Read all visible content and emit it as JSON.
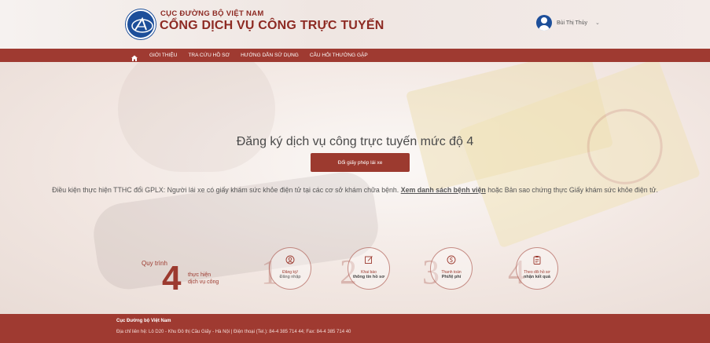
{
  "header": {
    "org_name": "CỤC ĐƯỜNG BỘ VIỆT NAM",
    "portal_name": "CỔNG DỊCH VỤ CÔNG TRỰC TUYẾN",
    "user_name": "Bùi Thị Thủy",
    "user_caret": "⌄"
  },
  "nav": {
    "items": [
      {
        "label": "GIỚI THIỆU"
      },
      {
        "label": "TRA CỨU HỒ SƠ"
      },
      {
        "label": "HƯỚNG DẪN SỬ DỤNG"
      },
      {
        "label": "CÂU HỎI THƯỜNG GẶP"
      }
    ]
  },
  "hero": {
    "title": "Đăng ký dịch vụ công trực tuyến mức độ 4",
    "cta_label": "Đổi giấy phép lái xe",
    "condition_prefix": "Điều kiện thực hiện TTHC đổi GPLX: Người lái xe có giấy khám sức khỏe điện tử tại các cơ sở khám chữa bệnh. ",
    "condition_link": "Xem danh sách bệnh viện",
    "condition_suffix": " hoặc Bản sao chứng thực Giấy khám sức khỏe điện tử."
  },
  "process": {
    "label": "Quy trình",
    "big_number": "4",
    "sub1": "thực hiện",
    "sub2": "dịch vụ công",
    "steps": [
      {
        "num": "1",
        "line1": "Đăng ký/",
        "line2": "Đăng nhập",
        "icon": "user-icon"
      },
      {
        "num": "2",
        "line1": "Khai báo",
        "line2": "thông tin hồ sơ",
        "icon": "edit-icon"
      },
      {
        "num": "3",
        "line1": "Thanh toán",
        "line2": "Phí/lệ phí",
        "icon": "payment-icon"
      },
      {
        "num": "4",
        "line1": "Theo dõi hồ sơ",
        "line2": "nhận kết quả",
        "icon": "clipboard-icon"
      }
    ]
  },
  "footer": {
    "org": "Cục Đường bộ Việt Nam",
    "address": "Địa chỉ liên hệ: Lô D20 - Khu Đô thị Cầu Giấy - Hà Nội | Điện thoại (Tel.): 84-4 385 714 44; Fax: 84-4 385 714 40"
  },
  "colors": {
    "brand": "#9f3a31",
    "brand_dark": "#8d2a23",
    "accent_blue": "#1d4f9a"
  }
}
